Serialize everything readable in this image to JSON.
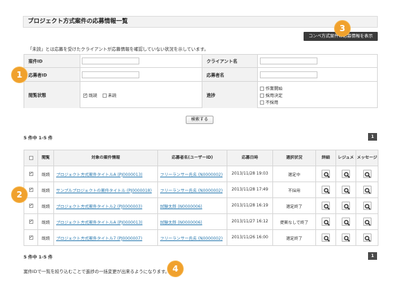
{
  "page": {
    "title": "プロジェクト方式案件の応募情報一覧",
    "top_button": "コンペ方式案件の応募情報を表示",
    "note": "「未読」とは応募を受けたクライアントが応募情報を確認していない状況を示しています。",
    "bottom_note": "案件IDで一覧を絞り込むことで進捗の一括変更が出来るようになります。"
  },
  "search": {
    "project_id_label": "案件ID",
    "client_name_label": "クライアント名",
    "applicant_id_label": "応募者ID",
    "applicant_name_label": "応募者名",
    "status_label": "閲覧状態",
    "status_options": [
      {
        "label": "既読",
        "checked": true
      },
      {
        "label": "未読",
        "checked": false
      }
    ],
    "progress_label": "進捗",
    "progress_options": [
      {
        "label": "作業開始",
        "checked": false
      },
      {
        "label": "採用決定",
        "checked": false
      },
      {
        "label": "不採用",
        "checked": false
      }
    ],
    "search_button": "検索する"
  },
  "results": {
    "count_text_top": "5 件中 1-5 件",
    "count_text_bottom": "5 件中 1-5 件",
    "page_number": "1",
    "columns": [
      "",
      "閲覧",
      "対象の案件情報",
      "応募者名(ユーザーID)",
      "応募日時",
      "選択状況",
      "詳細",
      "レジュメ",
      "メッセージ"
    ],
    "rows": [
      {
        "checked": true,
        "read": "既読",
        "project": "プロジェクト方式案件タイトルA (PJ0000013)",
        "applicant": "フリーランサー氏名 (N0000002)",
        "date": "2013/11/28 19:03",
        "status": "選定中"
      },
      {
        "checked": true,
        "read": "既読",
        "project": "サンプルプロジェクトの案件タイトル (PJ0000018)",
        "applicant": "フリーランサー氏名 (N0000002)",
        "date": "2013/11/28 17:49",
        "status": "不採用"
      },
      {
        "checked": true,
        "read": "既読",
        "project": "プロジェクト方式案件タイトル2 (PJ0000003)",
        "applicant": "試験太郎 (N0000006)",
        "date": "2013/11/28 16:19",
        "status": "選定終了"
      },
      {
        "checked": true,
        "read": "既読",
        "project": "プロジェクト方式案件タイトルA (PJ0000013)",
        "applicant": "試験太郎 (N0000006)",
        "date": "2013/11/27 16:12",
        "status": "提案なしで終了"
      },
      {
        "checked": true,
        "read": "既読",
        "project": "プロジェクト方式案件タイトル7 (PJ0000007)",
        "applicant": "フリーランサー氏名 (N0000002)",
        "date": "2013/11/26 16:00",
        "status": "選定終了"
      }
    ]
  },
  "markers": [
    "1",
    "2",
    "3",
    "4"
  ],
  "colors": {
    "marker": "#f0a12d",
    "link": "#2a7ab0",
    "dark_button": "#3a3a3a",
    "header_bg": "#f2f2f2"
  }
}
